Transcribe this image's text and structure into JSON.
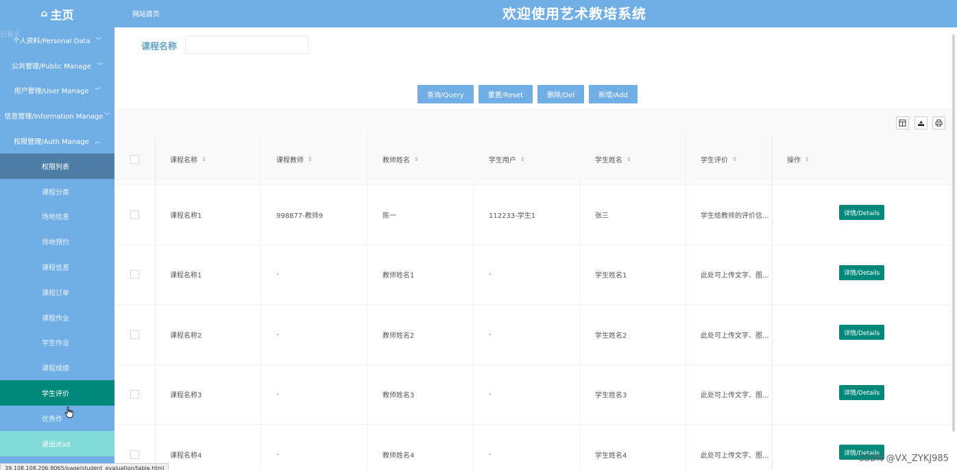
{
  "header": {
    "brand_icon": "home-icon",
    "brand_label": "主页",
    "site_link": "网站首页",
    "title": "欢迎使用艺术教培系统"
  },
  "sidebar": {
    "ghost_text": "后餐系",
    "groups": [
      {
        "label": "个人资料/Personal Data",
        "chevron": "chevron-down-icon"
      },
      {
        "label": "公共管理/Public Manage",
        "chevron": "chevron-down-icon"
      },
      {
        "label": "用户管理/User Manage",
        "chevron": "chevron-down-icon"
      },
      {
        "label": "信息管理/Information Manage",
        "chevron": "chevron-down-icon"
      },
      {
        "label": "权限管理/Auth Manage",
        "chevron": "chevron-up-icon"
      }
    ],
    "items": [
      {
        "label": "权限列表"
      },
      {
        "label": "课程分类"
      },
      {
        "label": "场地信息"
      },
      {
        "label": "场地预约"
      },
      {
        "label": "课程信息"
      },
      {
        "label": "课程订单"
      },
      {
        "label": "课程作业"
      },
      {
        "label": "学生作业"
      },
      {
        "label": "课程成绩"
      },
      {
        "label": "学生评价"
      },
      {
        "label": "优秀作"
      },
      {
        "label": "退出/Exit"
      }
    ]
  },
  "search": {
    "label": "课程名称",
    "value": ""
  },
  "actions": {
    "query": "查询/Query",
    "reset": "重置/Reset",
    "delete": "删除/Del",
    "add": "新增/Add"
  },
  "toolbar_icons": [
    "columns-icon",
    "export-icon",
    "print-icon"
  ],
  "table": {
    "headers": [
      "课程名称",
      "课程教师",
      "教师姓名",
      "学生用户",
      "学生姓名",
      "学生评价",
      "操作"
    ],
    "rows": [
      {
        "course": "课程名称1",
        "teacher": "998877-教师9",
        "teacher_name": "陈一",
        "student_user": "112233-学生1",
        "student_name": "张三",
        "evaluation": "学生给教师的评价信...",
        "action": "详情/Details"
      },
      {
        "course": "课程名称1",
        "teacher": "-",
        "teacher_name": "教师姓名1",
        "student_user": "-",
        "student_name": "学生姓名1",
        "evaluation": "此处可上传文字、图...",
        "action": "详情/Details"
      },
      {
        "course": "课程名称2",
        "teacher": "-",
        "teacher_name": "教师姓名2",
        "student_user": "-",
        "student_name": "学生姓名2",
        "evaluation": "此处可上传文字、图...",
        "action": "详情/Details"
      },
      {
        "course": "课程名称3",
        "teacher": "-",
        "teacher_name": "教师姓名3",
        "student_user": "-",
        "student_name": "学生姓名3",
        "evaluation": "此处可上传文字、图...",
        "action": "详情/Details"
      },
      {
        "course": "课程名称4",
        "teacher": "-",
        "teacher_name": "教师姓名4",
        "student_user": "-",
        "student_name": "学生姓名4",
        "evaluation": "此处可上传文字、图...",
        "action": "详情/Details"
      }
    ]
  },
  "statusbar": "39.108.108.206:8065/page/student_evaluation/table.html",
  "watermark": "CSDN @VX_ZYKJ985",
  "colors": {
    "primary": "#71aee5",
    "teal": "#00897b",
    "active_dark": "#4e7ea7",
    "exit": "#82dbd9"
  }
}
